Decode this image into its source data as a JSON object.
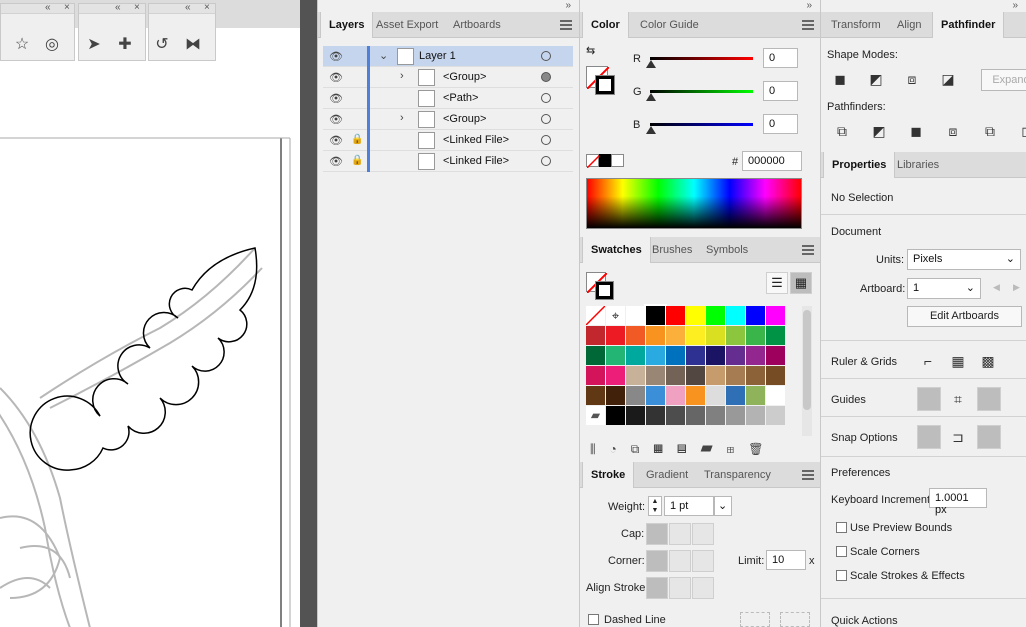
{
  "colors": {
    "selection": "#c6d5ee",
    "layer_bar": "#4f7fd6"
  },
  "tool_trays": [
    {
      "collapse": "«",
      "close": "×",
      "tools": [
        "star-tool-icon",
        "blob-brush-icon"
      ]
    },
    {
      "collapse": "«",
      "close": "×",
      "tools": [
        "direct-select-icon",
        "add-anchor-icon"
      ]
    },
    {
      "collapse": "«",
      "close": "×",
      "tools": [
        "rotate-icon",
        "reflect-icon"
      ]
    }
  ],
  "collapse_arrows": "»",
  "layers_panel": {
    "tabs": [
      "Layers",
      "Asset Export",
      "Artboards"
    ],
    "rows": [
      {
        "name": "Layer 1",
        "expanded": "⌄",
        "locked": ""
      },
      {
        "name": "<Group>",
        "expanded": "›",
        "locked": ""
      },
      {
        "name": "<Path>",
        "expanded": "",
        "locked": ""
      },
      {
        "name": "<Group>",
        "expanded": "›",
        "locked": ""
      },
      {
        "name": "<Linked File>",
        "expanded": "",
        "locked": "🔒"
      },
      {
        "name": "<Linked File>",
        "expanded": "",
        "locked": "🔒"
      }
    ]
  },
  "color_panel": {
    "tabs": [
      "Color",
      "Color Guide"
    ],
    "channels": [
      {
        "label": "R",
        "value": "0"
      },
      {
        "label": "G",
        "value": "0"
      },
      {
        "label": "B",
        "value": "0"
      }
    ],
    "hex_label": "#",
    "hex_value": "000000"
  },
  "swatches_panel": {
    "tabs": [
      "Swatches",
      "Brushes",
      "Symbols"
    ],
    "rows": [
      [
        "#ffffff",
        "#ffffff",
        "#ffffff",
        "#000000",
        "#ff0000",
        "#ffff00",
        "#00ff00",
        "#00ffff",
        "#0000ff",
        "#ff00ff"
      ],
      [
        "#c1272d",
        "#ed1c24",
        "#f15a24",
        "#f7931e",
        "#fbb03b",
        "#fcee21",
        "#d9e021",
        "#8cc63f",
        "#39b54a",
        "#009245"
      ],
      [
        "#006837",
        "#22b573",
        "#00a99d",
        "#29abe2",
        "#0071bc",
        "#2e3192",
        "#1b1464",
        "#662d91",
        "#93278f",
        "#9e005d"
      ],
      [
        "#d4145a",
        "#ed1e79",
        "#c7b299",
        "#998675",
        "#736357",
        "#534741",
        "#c69c6d",
        "#a67c52",
        "#8c6239",
        "#754c24"
      ],
      [
        "#603813",
        "#42210b",
        "#888888",
        "#3a8fd8",
        "#f0a0c0",
        "#f7931e",
        "#dddddd",
        "#2e6fb5",
        "#8fb35a",
        "#ffffff"
      ],
      [
        "#ffffff",
        "#000000",
        "#1a1a1a",
        "#333333",
        "#4d4d4d",
        "#666666",
        "#808080",
        "#999999",
        "#b3b3b3",
        "#cccccc"
      ]
    ]
  },
  "stroke_panel": {
    "tabs": [
      "Stroke",
      "Gradient",
      "Transparency"
    ],
    "weight_label": "Weight:",
    "weight_value": "1 pt",
    "cap_label": "Cap:",
    "corner_label": "Corner:",
    "limit_label": "Limit:",
    "limit_value": "10",
    "limit_unit": "x",
    "align_label": "Align Stroke:",
    "dashed_label": "Dashed Line"
  },
  "pathfinder_panel": {
    "tabs": [
      "Transform",
      "Align",
      "Pathfinder"
    ],
    "shape_modes_label": "Shape Modes:",
    "expand_label": "Expand",
    "pathfinders_label": "Pathfinders:"
  },
  "properties_panel": {
    "tabs": [
      "Properties",
      "Libraries"
    ],
    "selection": "No Selection",
    "document_label": "Document",
    "units_label": "Units:",
    "units_value": "Pixels",
    "artboard_label": "Artboard:",
    "artboard_value": "1",
    "edit_artboards": "Edit Artboards",
    "ruler_grids": "Ruler & Grids",
    "guides": "Guides",
    "snap_options": "Snap Options",
    "preferences": "Preferences",
    "keyboard_increment_label": "Keyboard Increment:",
    "keyboard_increment_value": "1.0001 px",
    "checkboxes": [
      "Use Preview Bounds",
      "Scale Corners",
      "Scale Strokes & Effects"
    ],
    "quick_actions": "Quick Actions"
  }
}
